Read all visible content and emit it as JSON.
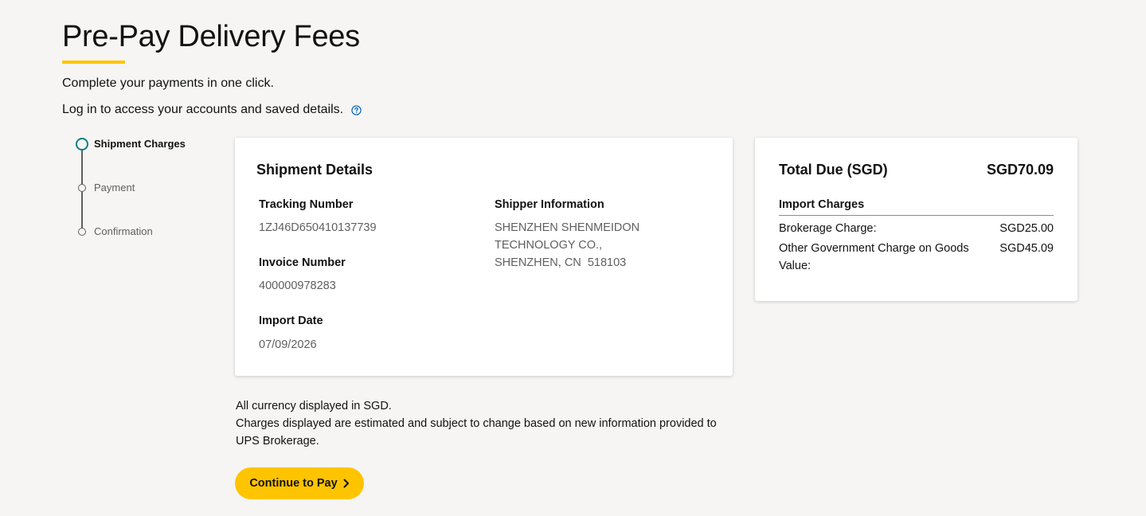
{
  "page": {
    "title": "Pre-Pay Delivery Fees",
    "intro_line_1": "Complete your payments in one click.",
    "intro_line_2": "Log in to access your accounts and saved details.",
    "help_icon": "question-circle-icon"
  },
  "stepper": {
    "steps": [
      {
        "label": "Shipment Charges",
        "state": "active"
      },
      {
        "label": "Payment",
        "state": "inactive"
      },
      {
        "label": "Confirmation",
        "state": "inactive"
      }
    ]
  },
  "shipment_details": {
    "title": "Shipment Details",
    "tracking_number_label": "Tracking Number",
    "tracking_number": "1ZJ46D650410137739",
    "invoice_number_label": "Invoice Number",
    "invoice_number": "400000978283",
    "import_date_label": "Import Date",
    "import_date": "07/09/2026",
    "shipper_info_label": "Shipper Information",
    "shipper_lines": [
      "SHENZHEN SHENMEIDON",
      "TECHNOLOGY CO.,",
      "SHENZHEN, CN  518103"
    ]
  },
  "total": {
    "title": "Total Due (SGD)",
    "amount": "SGD70.09",
    "charges_heading": "Import Charges",
    "charges": [
      {
        "name": "Brokerage Charge:",
        "amount": "SGD25.00"
      },
      {
        "name": "Other Government Charge on Goods Value:",
        "amount": "SGD45.09"
      }
    ]
  },
  "disclaimer": {
    "line_1": "All currency displayed in SGD.",
    "line_2": "Charges displayed are estimated and subject to change based on new information provided to UPS Brokerage."
  },
  "actions": {
    "continue_label": "Continue to Pay",
    "continue_icon": "chevron-right-icon"
  },
  "colors": {
    "accent": "#ffc400",
    "active_step": "#0a8080",
    "link_blue": "#0662bb",
    "background": "#f6f5f3"
  }
}
